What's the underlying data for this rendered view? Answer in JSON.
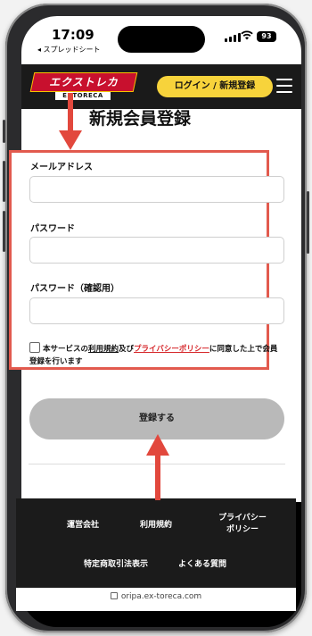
{
  "status": {
    "time": "17:09",
    "back_app": "◂ スプレッドシート",
    "battery": "93"
  },
  "header": {
    "logo_main": "エクストレカ",
    "logo_sub": "EXTORECA",
    "login_button": "ログイン / 新規登録"
  },
  "page": {
    "title": "新規会員登録"
  },
  "form": {
    "email_label": "メールアドレス",
    "password_label": "パスワード",
    "password_confirm_label": "パスワード（確認用）",
    "agreement_prefix": "本サービスの",
    "terms_link": "利用規約",
    "agreement_and": "及び",
    "privacy_link": "プライバシーポリシー",
    "agreement_suffix": "に同意した上で会員登録を行います",
    "submit": "登録する"
  },
  "footer": {
    "company": "運営会社",
    "terms": "利用規約",
    "privacy": "プライバシー\nポリシー",
    "commerce": "特定商取引法表示",
    "faq": "よくある質問"
  },
  "browser": {
    "url": "oripa.ex-toreca.com"
  },
  "colors": {
    "annotation": "#e2483d",
    "accent": "#f7d33b",
    "link": "#d6272b"
  }
}
